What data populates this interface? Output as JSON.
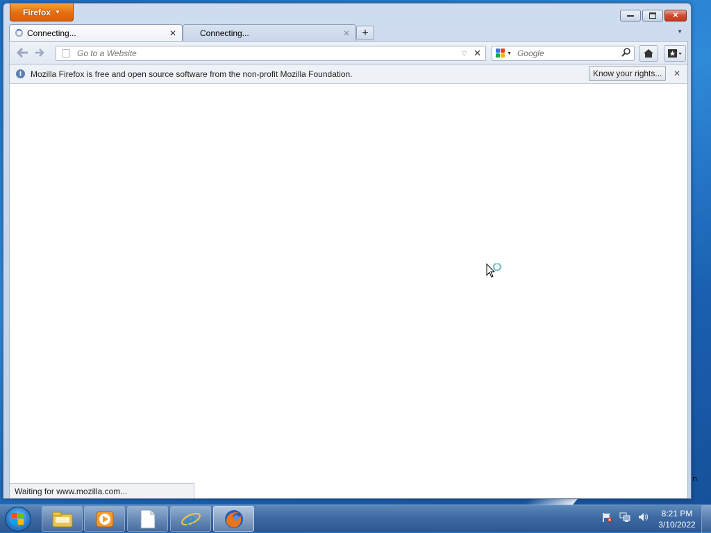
{
  "browser": {
    "menu_button_label": "Firefox",
    "tabs": [
      {
        "label": "Connecting...",
        "active": true
      },
      {
        "label": "Connecting...",
        "active": false
      }
    ],
    "new_tab_label": "+",
    "address_bar": {
      "placeholder": "Go to a Website",
      "value": ""
    },
    "search_bar": {
      "engine_icon": "google-icon",
      "placeholder": "Google",
      "value": ""
    },
    "notification": {
      "text": "Mozilla Firefox is free and open source software from the non-profit Mozilla Foundation.",
      "button_label": "Know your rights..."
    },
    "status_text": "Waiting for www.mozilla.com...",
    "accent_color": "#e66d0e"
  },
  "desktop": {
    "peek_text": "n"
  },
  "taskbar": {
    "items": [
      {
        "name": "windows-explorer",
        "icon": "folder-icon",
        "active": false
      },
      {
        "name": "windows-media-player",
        "icon": "media-player-icon",
        "active": false
      },
      {
        "name": "blank-document",
        "icon": "document-icon",
        "active": false
      },
      {
        "name": "internet-explorer",
        "icon": "ie-icon",
        "active": false
      },
      {
        "name": "firefox",
        "icon": "firefox-icon",
        "active": true
      }
    ],
    "clock": {
      "time": "8:21 PM",
      "date": "3/10/2022"
    }
  }
}
